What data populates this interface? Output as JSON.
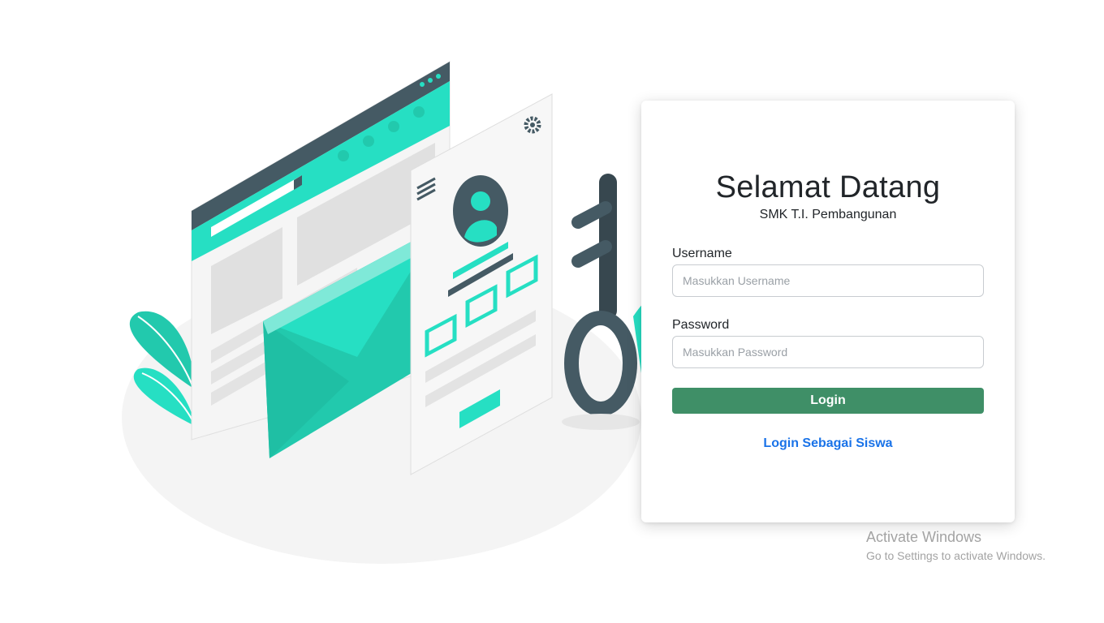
{
  "login": {
    "title": "Selamat Datang",
    "subtitle": "SMK T.I. Pembangunan",
    "username_label": "Username",
    "username_placeholder": "Masukkan Username",
    "username_value": "",
    "password_label": "Password",
    "password_placeholder": "Masukkan Password",
    "password_value": "",
    "login_button": "Login",
    "siswa_link": "Login Sebagai Siswa"
  },
  "watermark": {
    "title": "Activate Windows",
    "subtitle": "Go to Settings to activate Windows."
  },
  "colors": {
    "accent_teal": "#26dfc3",
    "dark_slate": "#455a64",
    "login_button": "#3f8f67",
    "link": "#1a73e8"
  },
  "illustration": {
    "icons": [
      "browser-window",
      "envelope",
      "profile-card",
      "gear-icon",
      "hamburger-menu-icon",
      "key",
      "leaves"
    ]
  }
}
